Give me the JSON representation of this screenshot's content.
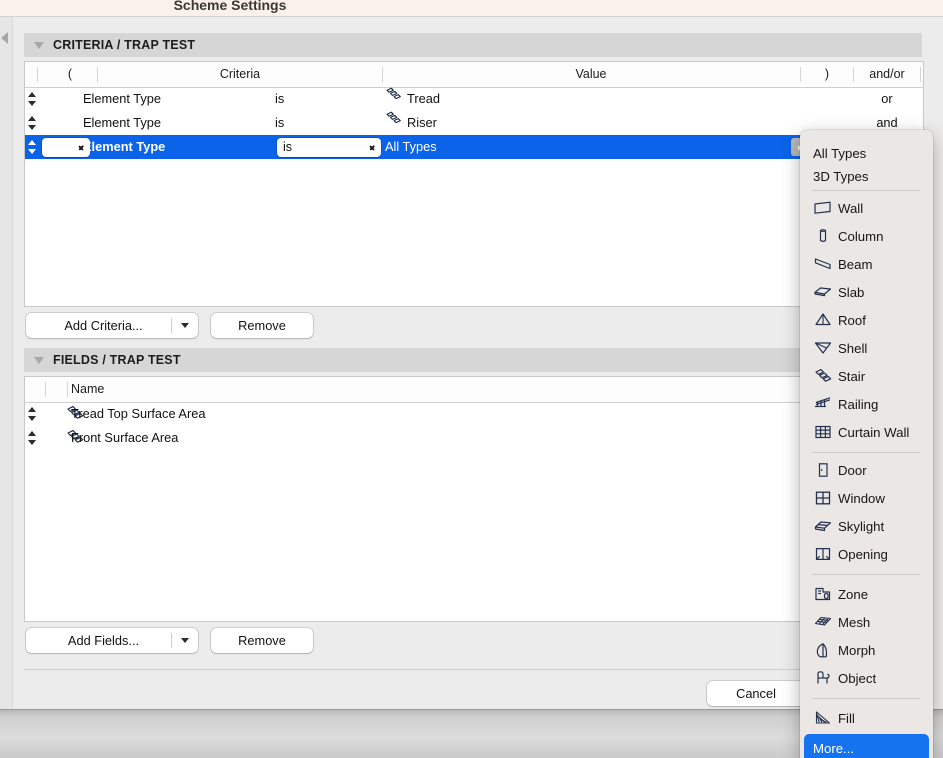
{
  "window": {
    "title": "Scheme Settings"
  },
  "criteria_section": {
    "header": "CRITERIA / TRAP TEST",
    "columns": [
      "(",
      "Criteria",
      "Value",
      ")",
      "and/or"
    ],
    "rows": [
      {
        "paren_open": "",
        "criteria": "Element Type",
        "operator": "is",
        "value": "Tread",
        "value_icon": "stair-icon",
        "paren_close": "",
        "andor": "or",
        "selected": false
      },
      {
        "paren_open": "",
        "criteria": "Element Type",
        "operator": "is",
        "value": "Riser",
        "value_icon": "stair-icon",
        "paren_close": "",
        "andor": "and",
        "selected": false
      },
      {
        "paren_open": "",
        "criteria": "Element Type",
        "operator": "is",
        "value": "All Types",
        "value_icon": "",
        "paren_close": "",
        "andor": "",
        "selected": true
      }
    ],
    "add_button": "Add Criteria...",
    "remove_button": "Remove"
  },
  "fields_section": {
    "header": "FIELDS / TRAP TEST",
    "columns": [
      "Name"
    ],
    "rows": [
      {
        "name": "Tread Top Surface Area",
        "icon": "stair-icon",
        "sort": "descending-arrow"
      },
      {
        "name": "Front Surface Area",
        "icon": "stair-icon",
        "sort": "descending-arrow"
      }
    ],
    "header_sort": "descending-arrow",
    "add_button": "Add Fields...",
    "remove_button": "Remove"
  },
  "footer": {
    "cancel_button": "Cancel"
  },
  "dropdown": {
    "items": [
      {
        "label": "All Types",
        "icon": "",
        "highlight": false
      },
      {
        "label": "3D Types",
        "icon": "",
        "highlight": false
      },
      {
        "separator": true
      },
      {
        "label": "Wall",
        "icon": "wall-icon",
        "highlight": false
      },
      {
        "label": "Column",
        "icon": "column-icon",
        "highlight": false
      },
      {
        "label": "Beam",
        "icon": "beam-icon",
        "highlight": false
      },
      {
        "label": "Slab",
        "icon": "slab-icon",
        "highlight": false
      },
      {
        "label": "Roof",
        "icon": "roof-icon",
        "highlight": false
      },
      {
        "label": "Shell",
        "icon": "shell-icon",
        "highlight": false
      },
      {
        "label": "Stair",
        "icon": "stair-icon",
        "highlight": false
      },
      {
        "label": "Railing",
        "icon": "railing-icon",
        "highlight": false
      },
      {
        "label": "Curtain Wall",
        "icon": "curtain-wall-icon",
        "highlight": false
      },
      {
        "separator": true
      },
      {
        "label": "Door",
        "icon": "door-icon",
        "highlight": false
      },
      {
        "label": "Window",
        "icon": "window-icon",
        "highlight": false
      },
      {
        "label": "Skylight",
        "icon": "skylight-icon",
        "highlight": false
      },
      {
        "label": "Opening",
        "icon": "opening-icon",
        "highlight": false
      },
      {
        "separator": true
      },
      {
        "label": "Zone",
        "icon": "zone-icon",
        "highlight": false
      },
      {
        "label": "Mesh",
        "icon": "mesh-icon",
        "highlight": false
      },
      {
        "label": "Morph",
        "icon": "morph-icon",
        "highlight": false
      },
      {
        "label": "Object",
        "icon": "object-icon",
        "highlight": false
      },
      {
        "separator": true
      },
      {
        "label": "Fill",
        "icon": "fill-icon",
        "highlight": false
      },
      {
        "label": "More...",
        "icon": "",
        "highlight": true
      }
    ]
  },
  "colors": {
    "selection_blue": "#0a63e8",
    "menu_highlight_blue": "#1573f0",
    "section_header_gray": "#d6d6d6",
    "dialog_gray": "#ececec",
    "menu_bg": "#ebe7e4",
    "title_strip": "#faf1ec"
  }
}
